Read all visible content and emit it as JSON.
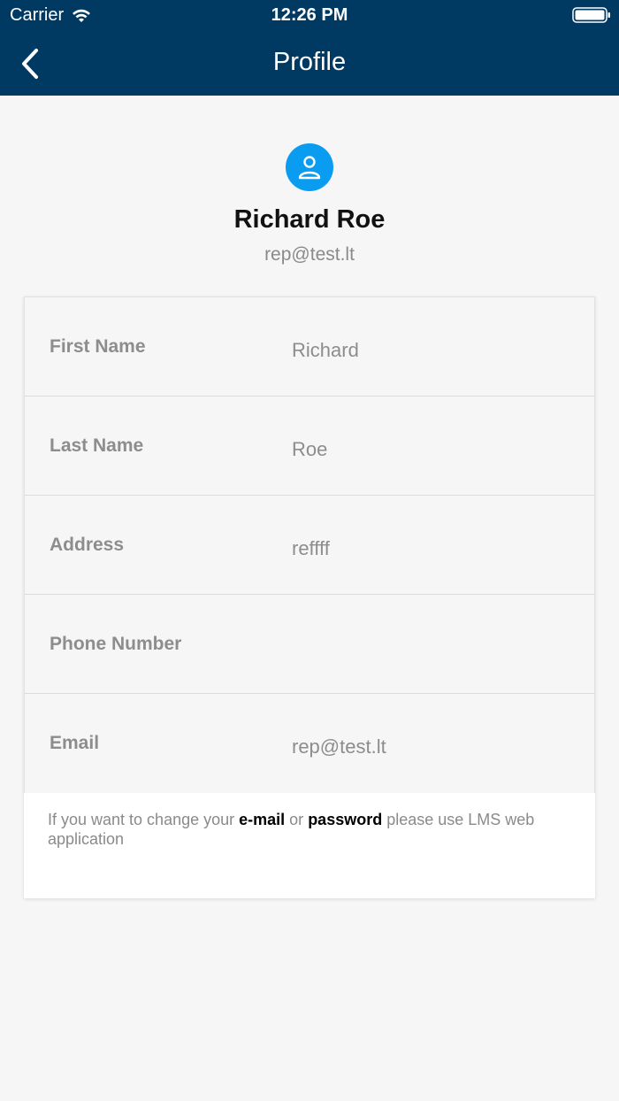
{
  "status_bar": {
    "carrier": "Carrier",
    "time": "12:26 PM"
  },
  "nav": {
    "title": "Profile"
  },
  "profile": {
    "name": "Richard Roe",
    "email": "rep@test.lt"
  },
  "fields": [
    {
      "label": "First Name",
      "value": "Richard"
    },
    {
      "label": "Last Name",
      "value": "Roe"
    },
    {
      "label": "Address",
      "value": "reffff"
    },
    {
      "label": "Phone Number",
      "value": ""
    },
    {
      "label": "Email",
      "value": "rep@test.lt"
    }
  ],
  "note": {
    "part1": "If you want to change your ",
    "email_word": "e-mail",
    "part2": " or ",
    "password_word": "password",
    "part3": " please use LMS web application"
  },
  "colors": {
    "header_bg": "#003a63",
    "avatar_bg": "#0a9cf0",
    "page_bg": "#f6f6f6"
  }
}
